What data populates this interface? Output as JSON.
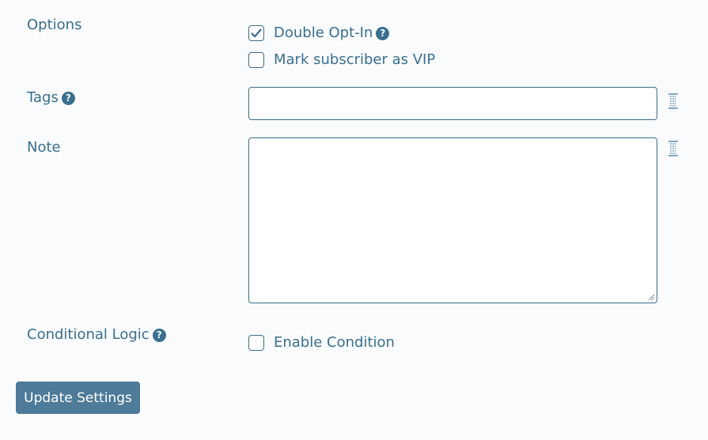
{
  "options": {
    "label": "Options",
    "double_opt_in": {
      "label": "Double Opt-In",
      "checked": true
    },
    "mark_vip": {
      "label": "Mark subscriber as VIP",
      "checked": false
    }
  },
  "tags": {
    "label": "Tags",
    "value": "",
    "placeholder": ""
  },
  "note": {
    "label": "Note",
    "value": "",
    "placeholder": ""
  },
  "conditional_logic": {
    "label": "Conditional Logic",
    "enable_condition": {
      "label": "Enable Condition",
      "checked": false
    }
  },
  "update_button": {
    "label": "Update Settings"
  },
  "colors": {
    "text": "#3a6f8f",
    "button_bg": "#4d7b99",
    "background": "#f9fbfc"
  },
  "icons": {
    "help": "question-circle-icon",
    "checkmark": "checkmark-icon",
    "field_action": "list-icon"
  }
}
